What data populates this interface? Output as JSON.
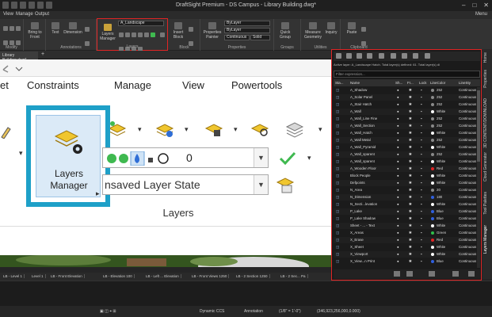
{
  "window": {
    "title": "DraftSight Premium - DS Campus - Library Building.dwg*",
    "menu_label": "Menu",
    "controls": [
      "–",
      "□",
      "✕"
    ]
  },
  "menubar": {
    "items": [
      "View",
      "Manage",
      "Output"
    ]
  },
  "ribbon": {
    "groups": [
      "Modify",
      "Annotations",
      "Layers",
      "Block",
      "Properties",
      "Groups",
      "Utilities",
      "Clipboard"
    ],
    "buttons": {
      "bring_to_front": "Bring to Front",
      "text": "Text",
      "dimension": "Dimension",
      "layers_manager": "Layers Manager",
      "insert_block": "Insert Block",
      "properties_painter": "Properties Painter",
      "quick_group": "Quick Group",
      "measure_geometry": "Measure Geometry",
      "inquiry": "Inquiry",
      "paste": "Paste"
    },
    "layer_combo": "A_Landscape",
    "color_combo": "ByLayer",
    "linetype_combo": "ByLayer",
    "linestyle_combo": "Continuous",
    "lineweight_combo": "Solid"
  },
  "doc_tab": "Library Building.dwg*",
  "zoom": {
    "tabs": [
      "et",
      "Constraints",
      "Manage",
      "View",
      "Powertools"
    ],
    "big_button_label": "Layers Manager",
    "layer_value": "0",
    "state_value": "nsaved Layer State",
    "group_label": "Layers"
  },
  "layout_tabs": [
    "LB - Level 1",
    "Level 1",
    "LB - Front Elevation",
    "LB - Elevation 100",
    "LB - Left ... Elevation",
    "LB - Front Views 1250",
    "LB - 2 Section 1250",
    "LB - 2 Sec... Pa"
  ],
  "statusbar": {
    "ccs": "Dynamic CCS",
    "annotation": "Annotation",
    "scale": "(1/8\" = 1'-0\")",
    "coords": "(346,923,256,000,0.000)"
  },
  "vertical_tabs": [
    "Home",
    "Properties",
    "3D CONTENT/DOWNLOAD",
    "Cloud Generator",
    "Tool Palettes",
    "Layers Manager"
  ],
  "palette": {
    "info": "Active layer: A_Landscape Hatch. Total layer(s) defined: 61. Total layer(s) di",
    "filter_placeholder": "Filter expression...",
    "columns": [
      "Sta...",
      "Name",
      "Sh...",
      "Fr...",
      "Lock",
      "LineColor",
      "LineSty"
    ],
    "rows": [
      {
        "name": "A_Shadow",
        "color": "#8a8a8a",
        "color_label": "252",
        "style": "Continuous"
      },
      {
        "name": "A_Solar Panel",
        "color": "#8a8a8a",
        "color_label": "252",
        "style": "Continuous"
      },
      {
        "name": "A_Stair Hatch",
        "color": "#8a8a8a",
        "color_label": "252",
        "style": "Continuous"
      },
      {
        "name": "A_Wall",
        "color": "#ffffff",
        "color_label": "White",
        "style": "Continuous"
      },
      {
        "name": "A_Wall_Line Fine",
        "color": "#8a8a8a",
        "color_label": "252",
        "style": "Continuous"
      },
      {
        "name": "A_Wall_Section",
        "color": "#8a8a8a",
        "color_label": "252",
        "style": "Continuous"
      },
      {
        "name": "A_Wall_Hatch",
        "color": "#ffffff",
        "color_label": "White",
        "style": "Continuous"
      },
      {
        "name": "A_Wall Metal",
        "color": "#8a8a8a",
        "color_label": "252",
        "style": "Continuous"
      },
      {
        "name": "A_Wall_Pyramid",
        "color": "#ffffff",
        "color_label": "White",
        "style": "Continuous"
      },
      {
        "name": "A_Wall_sparent",
        "color": "#8a8a8a",
        "color_label": "252",
        "style": "Continuous"
      },
      {
        "name": "A_Wall_sparent",
        "color": "#ffffff",
        "color_label": "White",
        "style": "Continuous"
      },
      {
        "name": "A_Wooden Floor",
        "color": "#e02424",
        "color_label": "Red",
        "style": "Continuous"
      },
      {
        "name": "Block People",
        "color": "#ffffff",
        "color_label": "White",
        "style": "Continuous"
      },
      {
        "name": "Defpoints",
        "color": "#ffffff",
        "color_label": "White",
        "style": "Continuous"
      },
      {
        "name": "N_Area",
        "color": "#8a8a8a",
        "color_label": "20",
        "style": "Continuous"
      },
      {
        "name": "N_Dimension",
        "color": "#3060e0",
        "color_label": "180",
        "style": "Continuous"
      },
      {
        "name": "N_Secti...levation",
        "color": "#ffffff",
        "color_label": "White",
        "style": "Continuous"
      },
      {
        "name": "P_Lake",
        "color": "#3060e0",
        "color_label": "Blue",
        "style": "Continuous"
      },
      {
        "name": "P_Lake Shadow",
        "color": "#3060e0",
        "color_label": "Blue",
        "style": "Continuous"
      },
      {
        "name": "Sheet - ... - Text",
        "color": "#ffffff",
        "color_label": "White",
        "style": "Continuous"
      },
      {
        "name": "X_Areas",
        "color": "#2fbf4a",
        "color_label": "Green",
        "style": "Continuous"
      },
      {
        "name": "X_Erase",
        "color": "#e02424",
        "color_label": "Red",
        "style": "Continuous"
      },
      {
        "name": "X_Sheet",
        "color": "#ffffff",
        "color_label": "White",
        "style": "Continuous"
      },
      {
        "name": "X_Viewport",
        "color": "#ffffff",
        "color_label": "White",
        "style": "Continuous"
      },
      {
        "name": "X_View...n Print",
        "color": "#3060e0",
        "color_label": "Blue",
        "style": "Continuous"
      }
    ]
  }
}
